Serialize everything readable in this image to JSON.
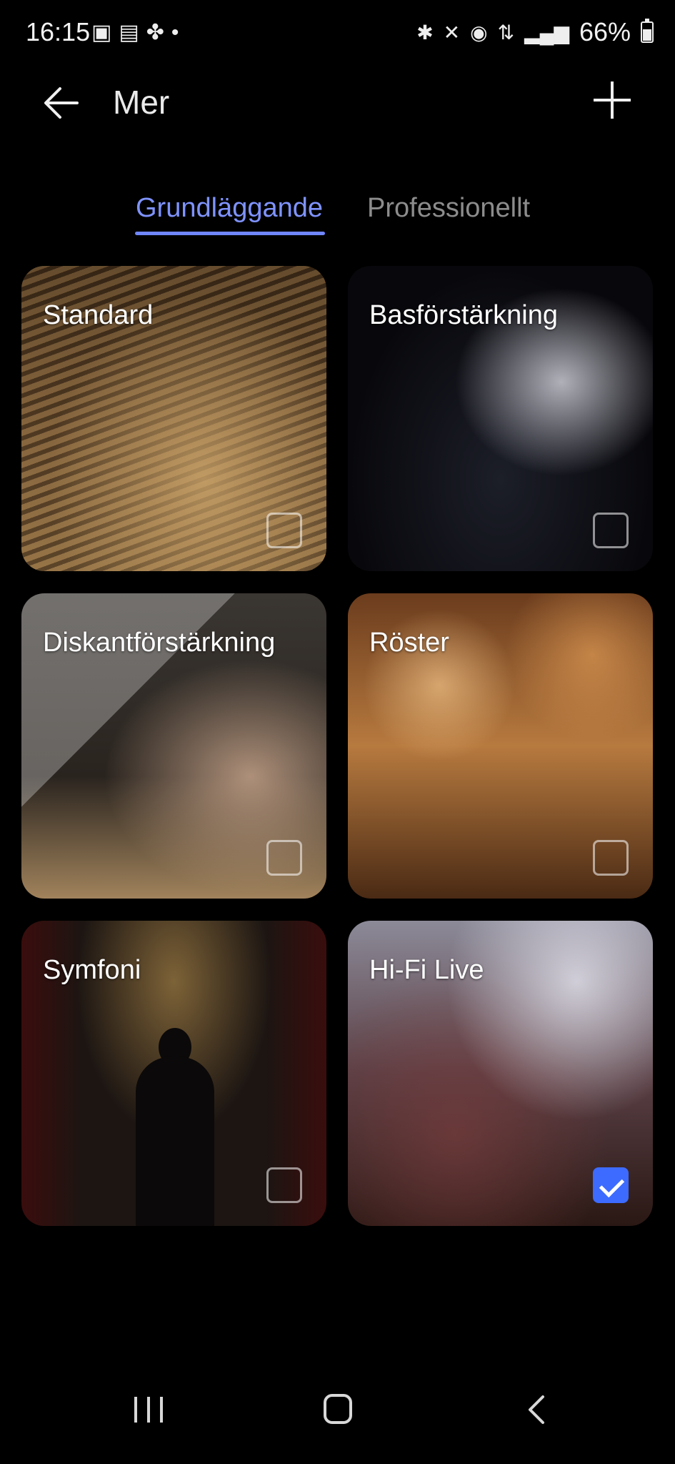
{
  "status_bar": {
    "time": "16:15",
    "battery": "66%",
    "left_icons": [
      "image-icon",
      "sim-icon",
      "pinwheel-icon",
      "dot-icon"
    ],
    "right_icons": [
      "bluetooth-icon",
      "mute-icon",
      "hotspot-icon",
      "5g-icon",
      "signal-icon"
    ]
  },
  "app_bar": {
    "title": "Mer"
  },
  "tabs": [
    {
      "label": "Grundläggande",
      "active": true
    },
    {
      "label": "Professionellt",
      "active": false
    }
  ],
  "presets": [
    {
      "label": "Standard",
      "checked": false
    },
    {
      "label": "Basförstärkning",
      "checked": false
    },
    {
      "label": "Diskantförstärkning",
      "checked": false
    },
    {
      "label": "Röster",
      "checked": false
    },
    {
      "label": "Symfoni",
      "checked": false
    },
    {
      "label": "Hi-Fi Live",
      "checked": true
    }
  ],
  "colors": {
    "accent": "#6f86ff",
    "checkbox_checked": "#3d6bff",
    "background": "#000000"
  }
}
